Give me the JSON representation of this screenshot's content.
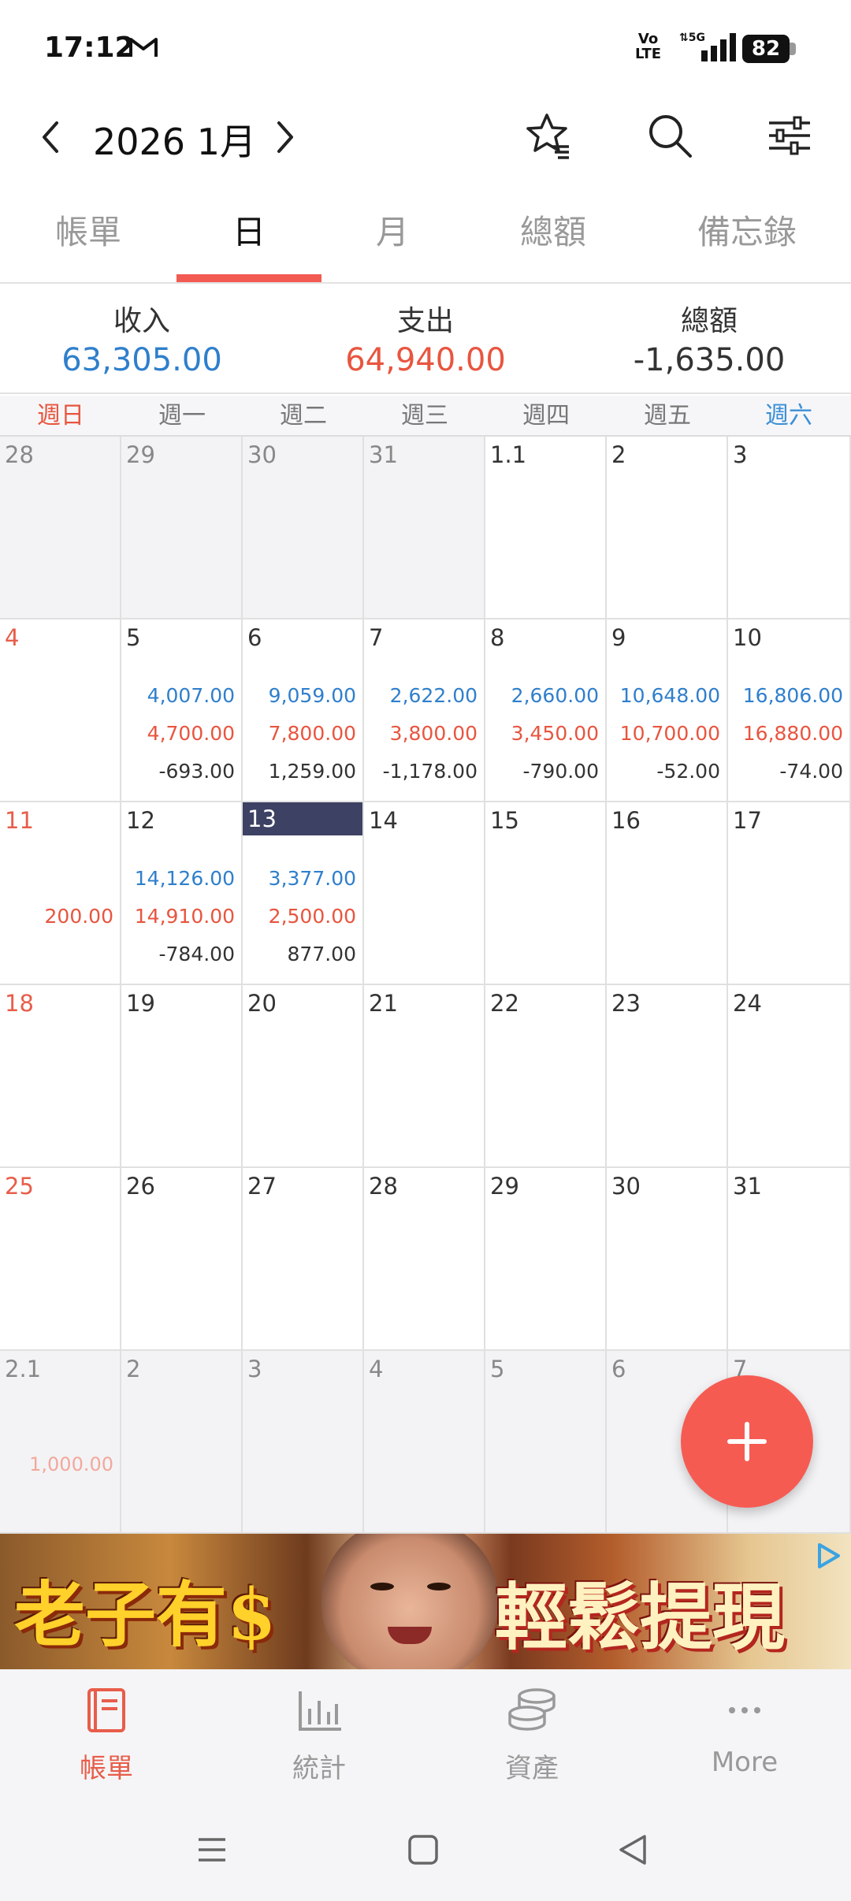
{
  "status_bar": {
    "time": "17:12",
    "volte": "Vo\nLTE",
    "network": "5G",
    "battery": "82"
  },
  "header": {
    "title": "2026 1月"
  },
  "tabs": [
    {
      "label": "帳單",
      "active": false
    },
    {
      "label": "日",
      "active": true
    },
    {
      "label": "月",
      "active": false
    },
    {
      "label": "總額",
      "active": false
    },
    {
      "label": "備忘錄",
      "active": false
    }
  ],
  "summary": {
    "income_label": "收入",
    "income_value": "63,305.00",
    "expense_label": "支出",
    "expense_value": "64,940.00",
    "total_label": "總額",
    "total_value": "-1,635.00"
  },
  "colors": {
    "income": "#2f7fcc",
    "expense": "#e8553f",
    "accent": "#f65b52",
    "today": "#3d4163",
    "saturday": "#3a8fd6"
  },
  "weekdays": [
    "週日",
    "週一",
    "週二",
    "週三",
    "週四",
    "週五",
    "週六"
  ],
  "calendar": [
    [
      {
        "day": "28",
        "other": true
      },
      {
        "day": "29",
        "other": true
      },
      {
        "day": "30",
        "other": true
      },
      {
        "day": "31",
        "other": true
      },
      {
        "day": "1.1"
      },
      {
        "day": "2"
      },
      {
        "day": "3"
      }
    ],
    [
      {
        "day": "4"
      },
      {
        "day": "5",
        "income": "4,007.00",
        "expense": "4,700.00",
        "total": "-693.00"
      },
      {
        "day": "6",
        "income": "9,059.00",
        "expense": "7,800.00",
        "total": "1,259.00"
      },
      {
        "day": "7",
        "income": "2,622.00",
        "expense": "3,800.00",
        "total": "-1,178.00"
      },
      {
        "day": "8",
        "income": "2,660.00",
        "expense": "3,450.00",
        "total": "-790.00"
      },
      {
        "day": "9",
        "income": "10,648.00",
        "expense": "10,700.00",
        "total": "-52.00"
      },
      {
        "day": "10",
        "income": "16,806.00",
        "expense": "16,880.00",
        "total": "-74.00"
      }
    ],
    [
      {
        "day": "11",
        "expense": "200.00"
      },
      {
        "day": "12",
        "income": "14,126.00",
        "expense": "14,910.00",
        "total": "-784.00"
      },
      {
        "day": "13",
        "today": true,
        "income": "3,377.00",
        "expense": "2,500.00",
        "total": "877.00"
      },
      {
        "day": "14"
      },
      {
        "day": "15"
      },
      {
        "day": "16"
      },
      {
        "day": "17"
      }
    ],
    [
      {
        "day": "18"
      },
      {
        "day": "19"
      },
      {
        "day": "20"
      },
      {
        "day": "21"
      },
      {
        "day": "22"
      },
      {
        "day": "23"
      },
      {
        "day": "24"
      }
    ],
    [
      {
        "day": "25"
      },
      {
        "day": "26"
      },
      {
        "day": "27"
      },
      {
        "day": "28"
      },
      {
        "day": "29"
      },
      {
        "day": "30"
      },
      {
        "day": "31"
      }
    ],
    [
      {
        "day": "2.1",
        "other": true,
        "expense": "1,000.00",
        "faded": true
      },
      {
        "day": "2",
        "other": true
      },
      {
        "day": "3",
        "other": true
      },
      {
        "day": "4",
        "other": true
      },
      {
        "day": "5",
        "other": true
      },
      {
        "day": "6",
        "other": true
      },
      {
        "day": "7",
        "other": true
      }
    ]
  ],
  "ad": {
    "text_left": "老子有$",
    "text_right": "輕鬆提現"
  },
  "bottom_nav": [
    {
      "label": "帳單",
      "icon": "ledger-book-icon",
      "active": true
    },
    {
      "label": "統計",
      "icon": "bar-chart-icon",
      "active": false
    },
    {
      "label": "資產",
      "icon": "coins-stack-icon",
      "active": false
    },
    {
      "label": "More",
      "icon": "more-dots-icon",
      "active": false
    }
  ]
}
